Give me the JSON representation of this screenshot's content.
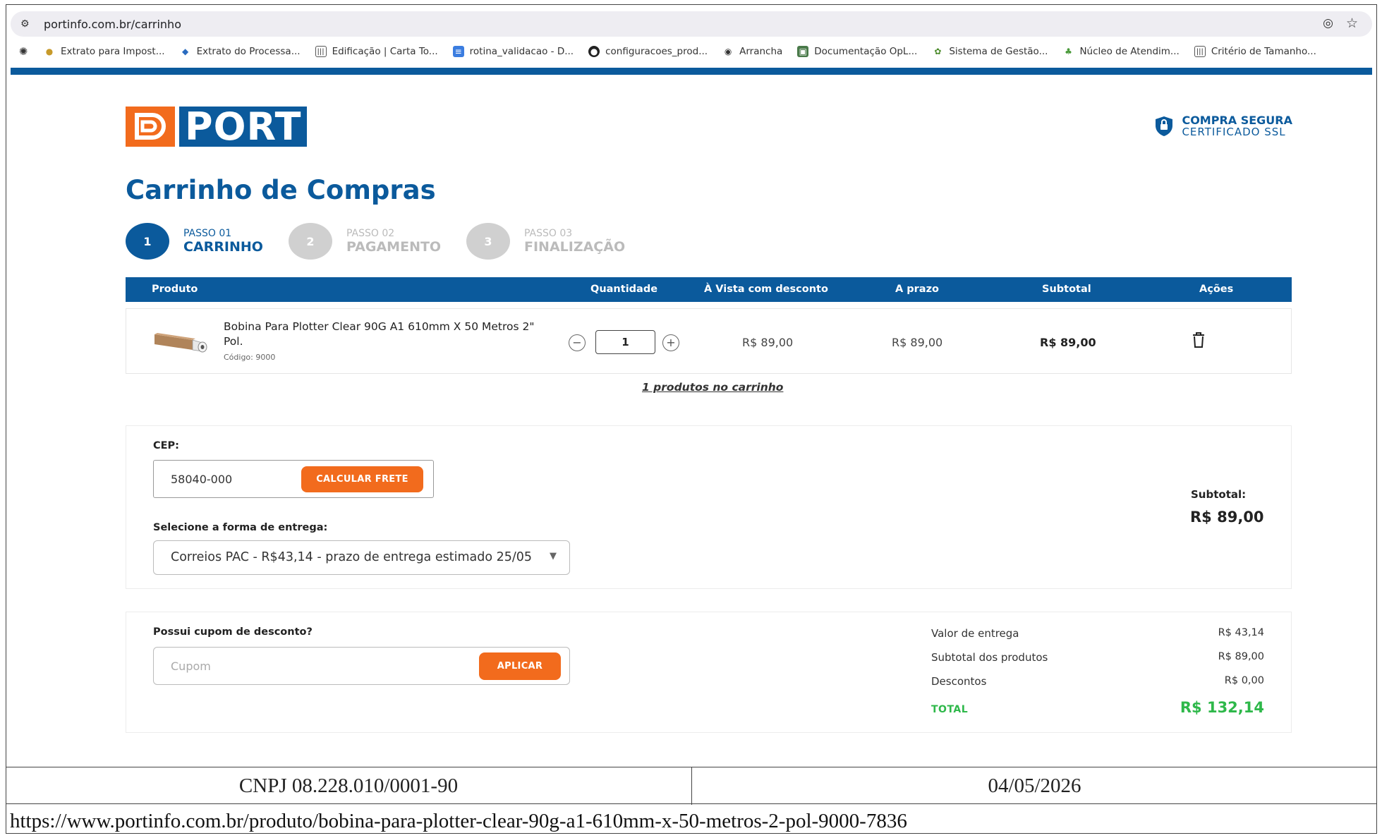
{
  "browser": {
    "url": "portinfo.com.br/carrinho",
    "bookmarks": [
      {
        "label": "Extrato para Impost...",
        "icon": "coins-icon"
      },
      {
        "label": "Extrato do Processa...",
        "icon": "process-icon"
      },
      {
        "label": "Edificação | Carta To...",
        "icon": "columns-icon"
      },
      {
        "label": "rotina_validacao - D...",
        "icon": "doc-icon"
      },
      {
        "label": "configuracoes_prod...",
        "icon": "github-icon"
      },
      {
        "label": "Arrancha",
        "icon": "globe-icon"
      },
      {
        "label": "Documentação OpL...",
        "icon": "image-icon"
      },
      {
        "label": "Sistema de Gestão...",
        "icon": "leaf-icon"
      },
      {
        "label": "Núcleo de Atendim...",
        "icon": "people-icon"
      },
      {
        "label": "Critério de Tamanho...",
        "icon": "columns-icon"
      }
    ]
  },
  "header": {
    "logo_text": "PORT",
    "secure_title": "COMPRA SEGURA",
    "secure_sub": "CERTIFICADO SSL"
  },
  "page_title": "Carrinho de Compras",
  "steps": [
    {
      "num": "1",
      "label": "PASSO 01",
      "name": "CARRINHO"
    },
    {
      "num": "2",
      "label": "PASSO 02",
      "name": "PAGAMENTO"
    },
    {
      "num": "3",
      "label": "PASSO 03",
      "name": "FINALIZAÇÃO"
    }
  ],
  "table": {
    "headers": {
      "produto": "Produto",
      "quantidade": "Quantidade",
      "avista": "À Vista com desconto",
      "aprazo": "A prazo",
      "subtotal": "Subtotal",
      "acoes": "Ações"
    },
    "rows": [
      {
        "name": "Bobina Para Plotter Clear 90G A1 610mm X 50 Metros 2\" Pol.",
        "code": "Código: 9000",
        "qty": "1",
        "avista": "R$ 89,00",
        "aprazo": "R$ 89,00",
        "subtotal": "R$ 89,00"
      }
    ]
  },
  "cart_count": "1 produtos no carrinho",
  "shipping": {
    "cep_label": "CEP:",
    "cep_value": "58040-000",
    "calc_button": "CALCULAR FRETE",
    "method_label": "Selecione a forma de entrega:",
    "method_value": "Correios PAC - R$43,14 - prazo de entrega estimado 25/05",
    "subtotal_label": "Subtotal:",
    "subtotal_value": "R$ 89,00"
  },
  "coupon": {
    "label": "Possui cupom de desconto?",
    "placeholder": "Cupom",
    "apply_button": "APLICAR"
  },
  "summary": {
    "delivery_label": "Valor de entrega",
    "delivery_value": "R$ 43,14",
    "products_label": "Subtotal dos produtos",
    "products_value": "R$ 89,00",
    "discount_label": "Descontos",
    "discount_value": "R$ 0,00",
    "total_label": "TOTAL",
    "total_value": "R$ 132,14"
  },
  "footer": {
    "cnpj": "CNPJ 08.228.010/0001-90",
    "date": "04/05/2026",
    "url": "https://www.portinfo.com.br/produto/bobina-para-plotter-clear-90g-a1-610mm-x-50-metros-2-pol-9000-7836"
  },
  "colors": {
    "brand_blue": "#0b5a9c",
    "brand_orange": "#f26b1d",
    "total_green": "#2eb84a"
  }
}
